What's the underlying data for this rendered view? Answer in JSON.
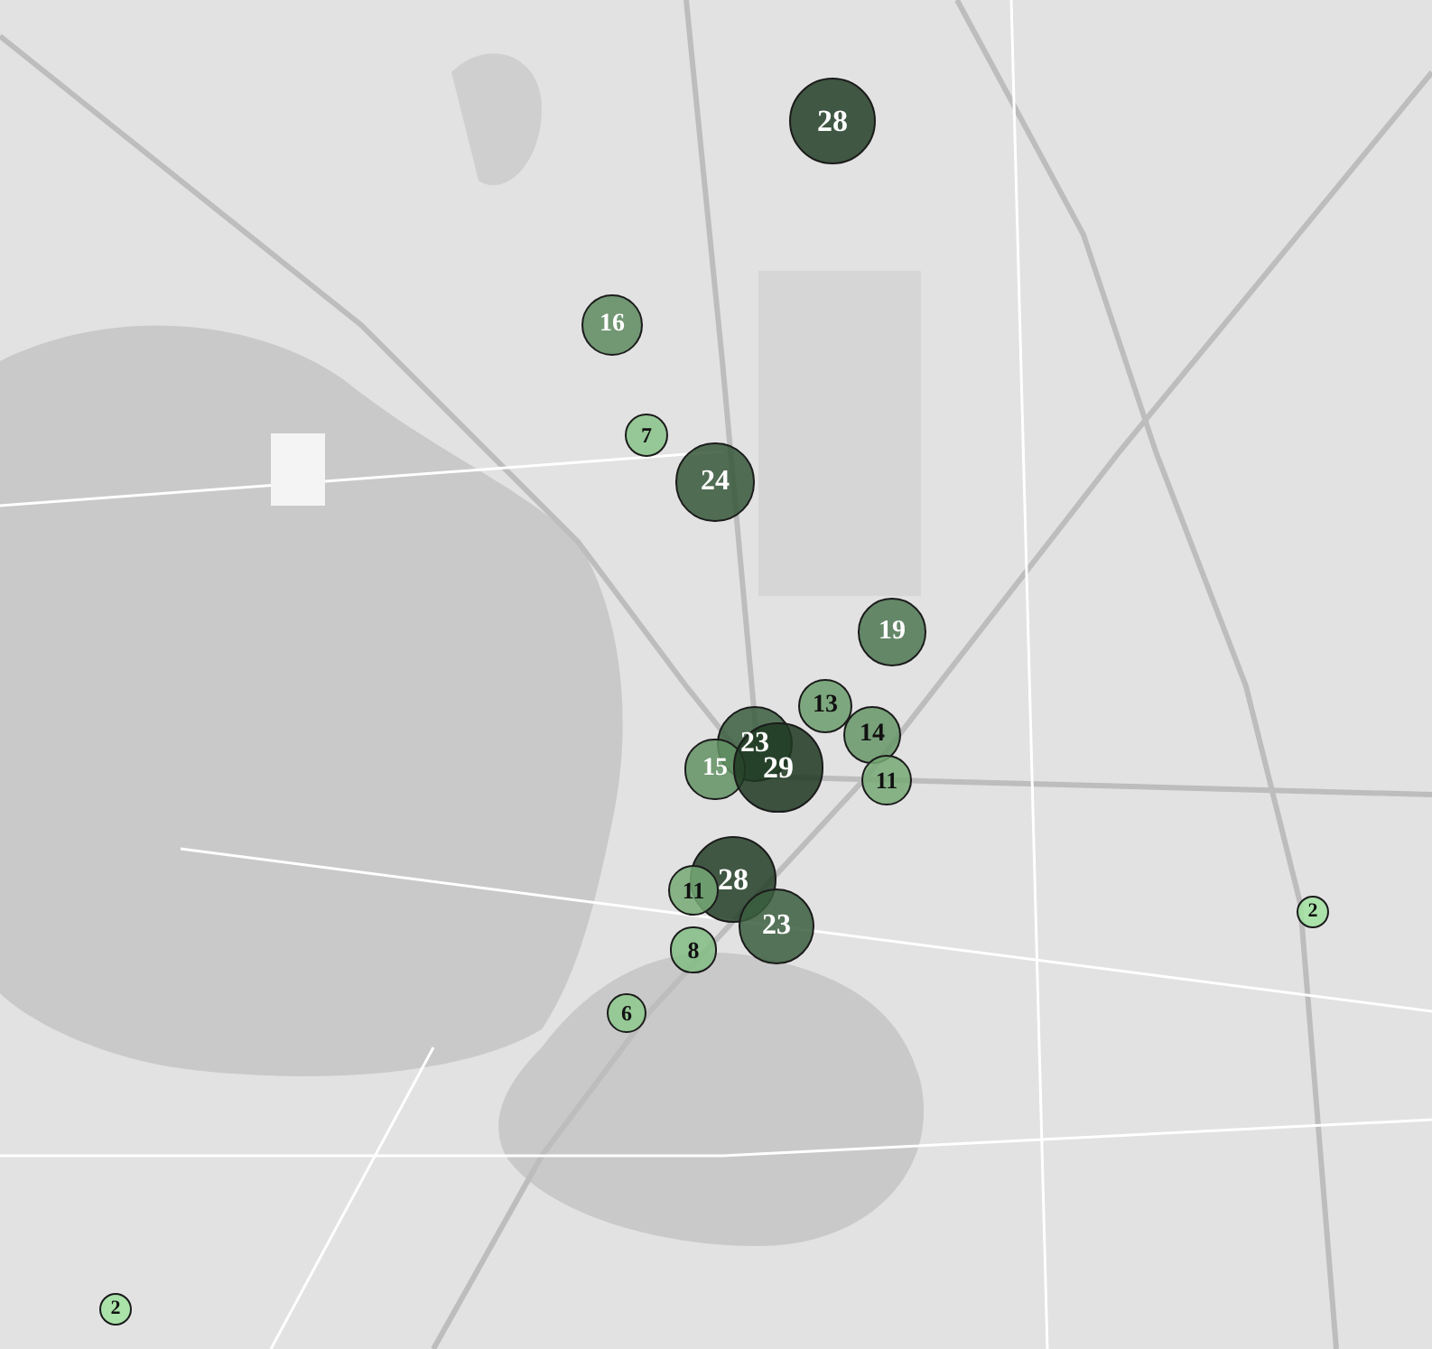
{
  "map": {
    "markers": [
      {
        "label": "28"
      },
      {
        "label": "16"
      },
      {
        "label": "7"
      },
      {
        "label": "24"
      },
      {
        "label": "19"
      },
      {
        "label": "13"
      },
      {
        "label": "14"
      },
      {
        "label": "23"
      },
      {
        "label": "15"
      },
      {
        "label": "29"
      },
      {
        "label": "11"
      },
      {
        "label": "28"
      },
      {
        "label": "11"
      },
      {
        "label": "2"
      },
      {
        "label": "23"
      },
      {
        "label": "8"
      },
      {
        "label": "6"
      },
      {
        "label": "2"
      }
    ]
  }
}
